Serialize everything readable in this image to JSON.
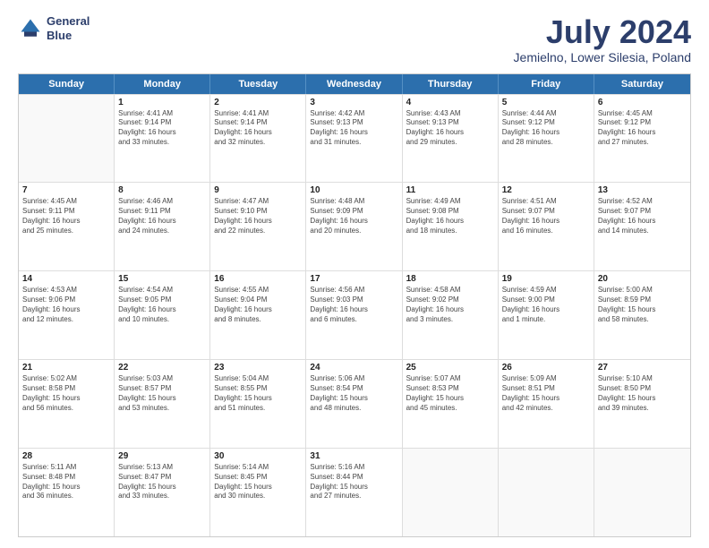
{
  "logo": {
    "line1": "General",
    "line2": "Blue"
  },
  "title": "July 2024",
  "subtitle": "Jemielno, Lower Silesia, Poland",
  "headers": [
    "Sunday",
    "Monday",
    "Tuesday",
    "Wednesday",
    "Thursday",
    "Friday",
    "Saturday"
  ],
  "rows": [
    [
      {
        "day": "",
        "text": ""
      },
      {
        "day": "1",
        "text": "Sunrise: 4:41 AM\nSunset: 9:14 PM\nDaylight: 16 hours\nand 33 minutes."
      },
      {
        "day": "2",
        "text": "Sunrise: 4:41 AM\nSunset: 9:14 PM\nDaylight: 16 hours\nand 32 minutes."
      },
      {
        "day": "3",
        "text": "Sunrise: 4:42 AM\nSunset: 9:13 PM\nDaylight: 16 hours\nand 31 minutes."
      },
      {
        "day": "4",
        "text": "Sunrise: 4:43 AM\nSunset: 9:13 PM\nDaylight: 16 hours\nand 29 minutes."
      },
      {
        "day": "5",
        "text": "Sunrise: 4:44 AM\nSunset: 9:12 PM\nDaylight: 16 hours\nand 28 minutes."
      },
      {
        "day": "6",
        "text": "Sunrise: 4:45 AM\nSunset: 9:12 PM\nDaylight: 16 hours\nand 27 minutes."
      }
    ],
    [
      {
        "day": "7",
        "text": "Sunrise: 4:45 AM\nSunset: 9:11 PM\nDaylight: 16 hours\nand 25 minutes."
      },
      {
        "day": "8",
        "text": "Sunrise: 4:46 AM\nSunset: 9:11 PM\nDaylight: 16 hours\nand 24 minutes."
      },
      {
        "day": "9",
        "text": "Sunrise: 4:47 AM\nSunset: 9:10 PM\nDaylight: 16 hours\nand 22 minutes."
      },
      {
        "day": "10",
        "text": "Sunrise: 4:48 AM\nSunset: 9:09 PM\nDaylight: 16 hours\nand 20 minutes."
      },
      {
        "day": "11",
        "text": "Sunrise: 4:49 AM\nSunset: 9:08 PM\nDaylight: 16 hours\nand 18 minutes."
      },
      {
        "day": "12",
        "text": "Sunrise: 4:51 AM\nSunset: 9:07 PM\nDaylight: 16 hours\nand 16 minutes."
      },
      {
        "day": "13",
        "text": "Sunrise: 4:52 AM\nSunset: 9:07 PM\nDaylight: 16 hours\nand 14 minutes."
      }
    ],
    [
      {
        "day": "14",
        "text": "Sunrise: 4:53 AM\nSunset: 9:06 PM\nDaylight: 16 hours\nand 12 minutes."
      },
      {
        "day": "15",
        "text": "Sunrise: 4:54 AM\nSunset: 9:05 PM\nDaylight: 16 hours\nand 10 minutes."
      },
      {
        "day": "16",
        "text": "Sunrise: 4:55 AM\nSunset: 9:04 PM\nDaylight: 16 hours\nand 8 minutes."
      },
      {
        "day": "17",
        "text": "Sunrise: 4:56 AM\nSunset: 9:03 PM\nDaylight: 16 hours\nand 6 minutes."
      },
      {
        "day": "18",
        "text": "Sunrise: 4:58 AM\nSunset: 9:02 PM\nDaylight: 16 hours\nand 3 minutes."
      },
      {
        "day": "19",
        "text": "Sunrise: 4:59 AM\nSunset: 9:00 PM\nDaylight: 16 hours\nand 1 minute."
      },
      {
        "day": "20",
        "text": "Sunrise: 5:00 AM\nSunset: 8:59 PM\nDaylight: 15 hours\nand 58 minutes."
      }
    ],
    [
      {
        "day": "21",
        "text": "Sunrise: 5:02 AM\nSunset: 8:58 PM\nDaylight: 15 hours\nand 56 minutes."
      },
      {
        "day": "22",
        "text": "Sunrise: 5:03 AM\nSunset: 8:57 PM\nDaylight: 15 hours\nand 53 minutes."
      },
      {
        "day": "23",
        "text": "Sunrise: 5:04 AM\nSunset: 8:55 PM\nDaylight: 15 hours\nand 51 minutes."
      },
      {
        "day": "24",
        "text": "Sunrise: 5:06 AM\nSunset: 8:54 PM\nDaylight: 15 hours\nand 48 minutes."
      },
      {
        "day": "25",
        "text": "Sunrise: 5:07 AM\nSunset: 8:53 PM\nDaylight: 15 hours\nand 45 minutes."
      },
      {
        "day": "26",
        "text": "Sunrise: 5:09 AM\nSunset: 8:51 PM\nDaylight: 15 hours\nand 42 minutes."
      },
      {
        "day": "27",
        "text": "Sunrise: 5:10 AM\nSunset: 8:50 PM\nDaylight: 15 hours\nand 39 minutes."
      }
    ],
    [
      {
        "day": "28",
        "text": "Sunrise: 5:11 AM\nSunset: 8:48 PM\nDaylight: 15 hours\nand 36 minutes."
      },
      {
        "day": "29",
        "text": "Sunrise: 5:13 AM\nSunset: 8:47 PM\nDaylight: 15 hours\nand 33 minutes."
      },
      {
        "day": "30",
        "text": "Sunrise: 5:14 AM\nSunset: 8:45 PM\nDaylight: 15 hours\nand 30 minutes."
      },
      {
        "day": "31",
        "text": "Sunrise: 5:16 AM\nSunset: 8:44 PM\nDaylight: 15 hours\nand 27 minutes."
      },
      {
        "day": "",
        "text": ""
      },
      {
        "day": "",
        "text": ""
      },
      {
        "day": "",
        "text": ""
      }
    ]
  ]
}
